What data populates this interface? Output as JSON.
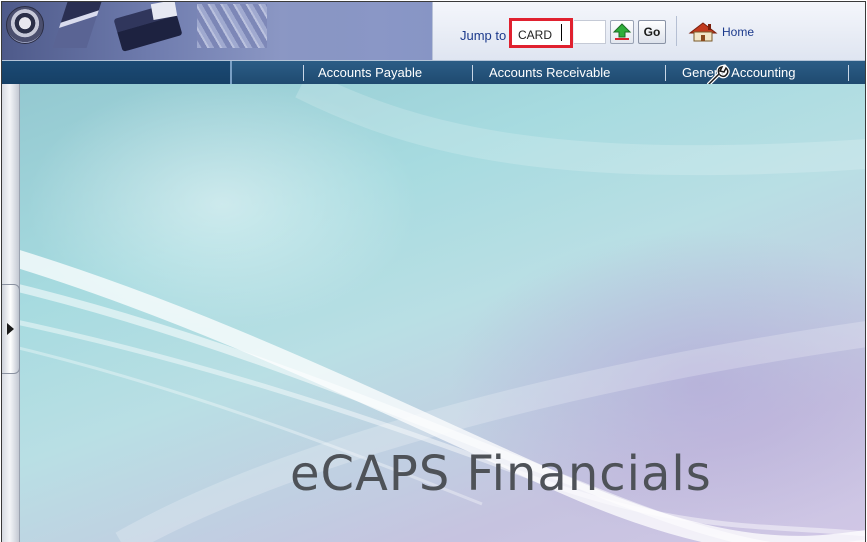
{
  "toolbar": {
    "jump_label": "Jump to",
    "jump_value": "CARD",
    "go_label": "Go",
    "home_label": "Home",
    "icons": {
      "up": "upload-arrow-icon",
      "home": "home-icon",
      "seal": "seal-logo"
    }
  },
  "nav": {
    "items": [
      {
        "label": "Accounts Payable"
      },
      {
        "label": "Accounts Receivable"
      },
      {
        "label": "General Accounting"
      }
    ],
    "cursor_icon": "wrench-icon"
  },
  "main": {
    "title": "eCAPS Financials"
  },
  "colors": {
    "nav_bg": "#1f4a70",
    "highlight": "#e0212f",
    "link": "#1c3a8c",
    "title": "#4e5258"
  }
}
